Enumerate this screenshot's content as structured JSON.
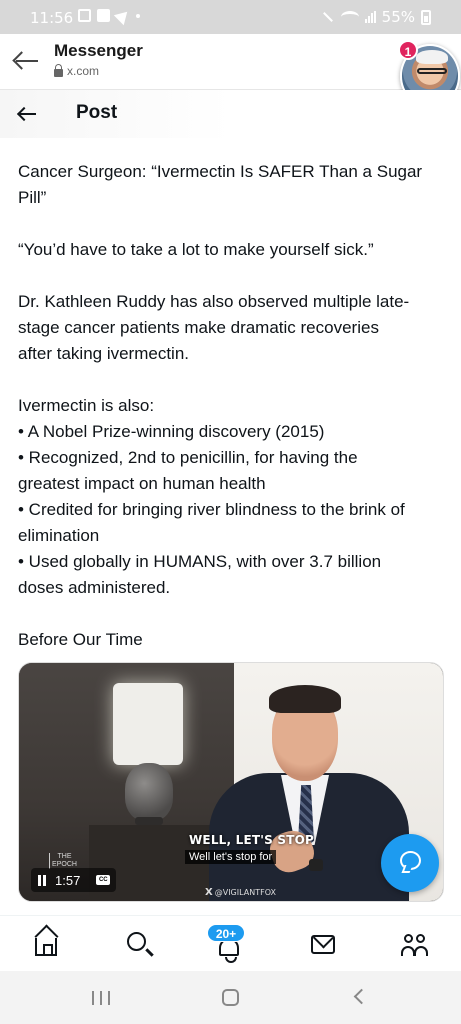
{
  "status_bar": {
    "time": "11:56",
    "battery": "55%"
  },
  "app_bar": {
    "title": "Messenger",
    "url": "x.com"
  },
  "chat_head": {
    "badge_count": "1"
  },
  "post_header": {
    "title": "Post"
  },
  "post": {
    "paragraphs": [
      [
        "Cancer Surgeon: “Ivermectin Is SAFER Than a Sugar",
        "Pill”"
      ],
      [
        "“You’d have to take a lot to make yourself sick.”"
      ],
      [
        "Dr. Kathleen Ruddy has also observed multiple late-",
        "stage cancer patients make dramatic recoveries",
        "after taking ivermectin."
      ],
      [
        "Ivermectin is also:",
        "• A Nobel Prize-winning discovery (2015)",
        "• Recognized, 2nd to penicillin, for having the",
        "greatest impact on human health",
        "• Credited for bringing river blindness to the brink of",
        "elimination",
        "• Used globally in HUMANS, with over 3.7 billion",
        "doses administered."
      ],
      [
        "Before Our Time"
      ]
    ]
  },
  "video": {
    "caption_upper": "WELL, LET'S STOP",
    "caption_lower": "Well let's stop for",
    "time": "1:57",
    "watermark_left": "THE EPOCH",
    "watermark_handle": "@VIGILANTFOX",
    "progress_fraction": 0.0
  },
  "tab_bar": {
    "notification_badge": "20+",
    "items": [
      "home-icon",
      "search-icon",
      "bell-icon",
      "mail-icon",
      "people-icon"
    ]
  },
  "colors": {
    "accent": "#1d9bf0",
    "badge_red": "#e0245e",
    "text": "#0f1419"
  }
}
